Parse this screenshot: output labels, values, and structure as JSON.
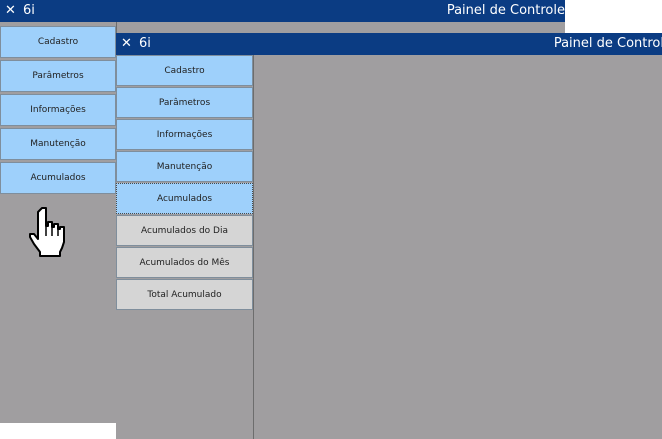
{
  "back_window": {
    "app_name": "6i",
    "panel_title": "Painel de Controle",
    "menu": [
      "Cadastro",
      "Parâmetros",
      "Informações",
      "Manutenção",
      "Acumulados"
    ]
  },
  "front_window": {
    "app_name": "6i",
    "panel_title": "Painel de Controle",
    "menu": [
      "Cadastro",
      "Parâmetros",
      "Informações",
      "Manutenção",
      "Acumulados"
    ],
    "submenu": [
      "Acumulados do Dia",
      "Acumulados do Mês",
      "Total Acumulado"
    ],
    "selected_item": "Acumulados"
  },
  "colors": {
    "titlebar": "#0b3c83",
    "button_blue": "#9ed0fb",
    "button_grey": "#d5d5d5",
    "background": "#a09ea0"
  },
  "icons": [
    "close-icon",
    "hand-pointer-cursor-icon"
  ]
}
